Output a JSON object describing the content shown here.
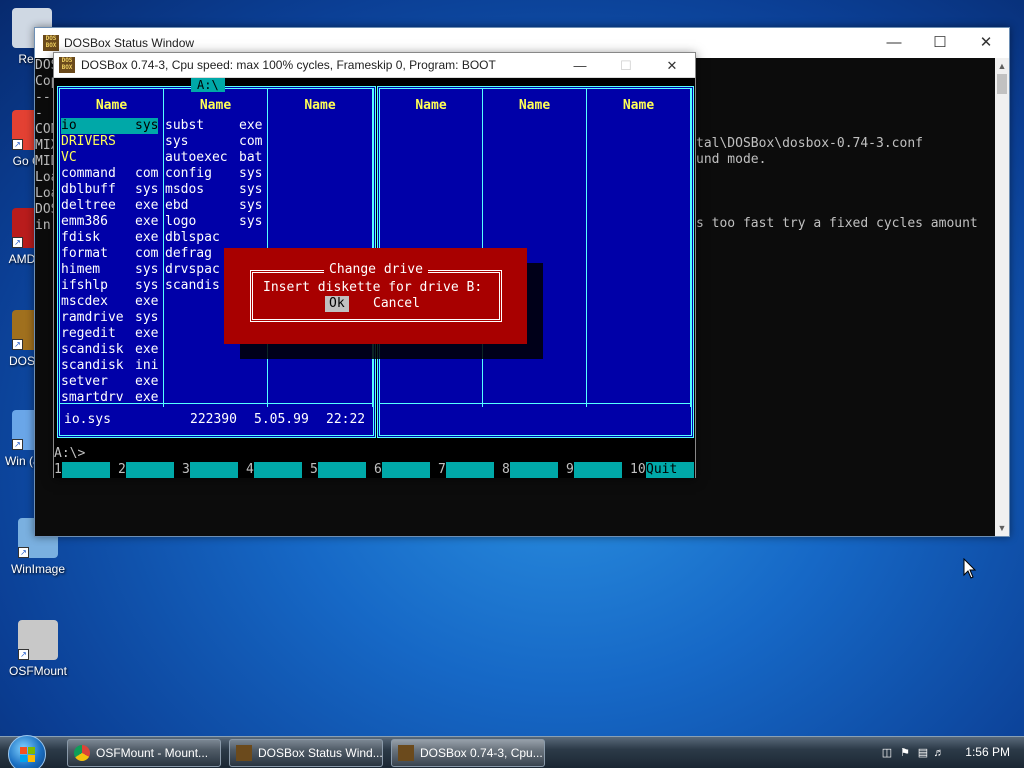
{
  "desktop": {
    "icons": [
      {
        "label": "Recy"
      },
      {
        "label": "Go Chr"
      },
      {
        "label": "AMD Ma"
      },
      {
        "label": "DOS 0.7"
      },
      {
        "label": "Win (admi"
      },
      {
        "label": "WinImage"
      },
      {
        "label": "OSFMount"
      }
    ]
  },
  "status_window": {
    "title": "DOSBox Status Window",
    "left_fragments": [
      "DOS",
      "Cop",
      "---",
      "CON",
      "MIX",
      "MID",
      "Loa",
      "Loa",
      "DOS",
      "in"
    ],
    "lines": [
      "tal\\DOSBox\\dosbox-0.74-3.conf",
      "und mode.",
      "s too fast try a fixed cycles amount"
    ]
  },
  "dosbox_window": {
    "title": "DOSBox 0.74-3, Cpu speed: max 100% cycles, Frameskip  0, Program:    BOOT",
    "icon_text": "DOS BOX",
    "path_tag": "A:\\",
    "col_header": "Name",
    "left_col1": [
      {
        "name": "io",
        "ext": "sys"
      },
      {
        "name": "DRIVERS",
        "ext": ""
      },
      {
        "name": "VC",
        "ext": ""
      },
      {
        "name": "command",
        "ext": "com"
      },
      {
        "name": "dblbuff",
        "ext": "sys"
      },
      {
        "name": "deltree",
        "ext": "exe"
      },
      {
        "name": "emm386",
        "ext": "exe"
      },
      {
        "name": "fdisk",
        "ext": "exe"
      },
      {
        "name": "format",
        "ext": "com"
      },
      {
        "name": "himem",
        "ext": "sys"
      },
      {
        "name": "ifshlp",
        "ext": "sys"
      },
      {
        "name": "mscdex",
        "ext": "exe"
      },
      {
        "name": "ramdrive",
        "ext": "sys"
      },
      {
        "name": "regedit",
        "ext": "exe"
      },
      {
        "name": "scandisk",
        "ext": "exe"
      },
      {
        "name": "scandisk",
        "ext": "ini"
      },
      {
        "name": "setver",
        "ext": "exe"
      },
      {
        "name": "smartdrv",
        "ext": "exe"
      }
    ],
    "left_col2": [
      {
        "name": "subst",
        "ext": "exe"
      },
      {
        "name": "sys",
        "ext": "com"
      },
      {
        "name": "autoexec",
        "ext": "bat"
      },
      {
        "name": "config",
        "ext": "sys"
      },
      {
        "name": "msdos",
        "ext": "sys"
      },
      {
        "name": "ebd",
        "ext": "sys"
      },
      {
        "name": "logo",
        "ext": "sys"
      },
      {
        "name": "dblspac",
        "ext": ""
      },
      {
        "name": "defrag",
        "ext": ""
      },
      {
        "name": "drvspac",
        "ext": ""
      },
      {
        "name": "scandis",
        "ext": ""
      }
    ],
    "info": {
      "file": "io.sys",
      "size": "222390",
      "date": "5.05.99",
      "time": "22:22"
    },
    "cmdline": "A:\\>",
    "fkeys": [
      {
        "num": "1",
        "label": ""
      },
      {
        "num": "2",
        "label": ""
      },
      {
        "num": "3",
        "label": ""
      },
      {
        "num": "4",
        "label": ""
      },
      {
        "num": "5",
        "label": ""
      },
      {
        "num": "6",
        "label": ""
      },
      {
        "num": "7",
        "label": ""
      },
      {
        "num": "8",
        "label": ""
      },
      {
        "num": "9",
        "label": ""
      },
      {
        "num": "10",
        "label": "Quit"
      }
    ],
    "dialog": {
      "title": "Change drive",
      "message": "Insert diskette for drive B:",
      "ok": "Ok",
      "cancel": "Cancel"
    }
  },
  "taskbar": {
    "buttons": [
      {
        "label": "OSFMount - Mount..."
      },
      {
        "label": "DOSBox Status Wind..."
      },
      {
        "label": "DOSBox 0.74-3, Cpu..."
      }
    ],
    "clock": "1:56 PM"
  },
  "colors": {
    "dos_blue": "#0000a8",
    "dos_cyan": "#00a8a8",
    "dos_red": "#a80000",
    "dos_yellow": "#ffff55"
  }
}
